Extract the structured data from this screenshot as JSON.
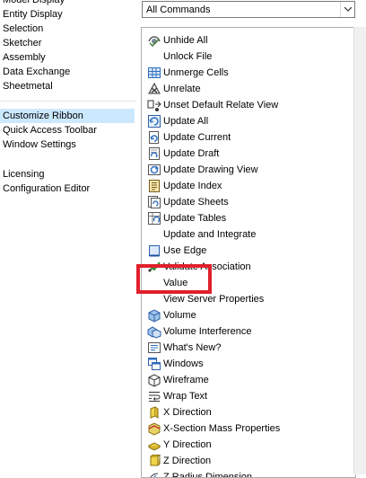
{
  "left_pane": {
    "items": [
      {
        "label": "Model Display",
        "selected": false
      },
      {
        "label": "Entity Display",
        "selected": false
      },
      {
        "label": "Selection",
        "selected": false
      },
      {
        "label": "Sketcher",
        "selected": false
      },
      {
        "label": "Assembly",
        "selected": false
      },
      {
        "label": "Data Exchange",
        "selected": false
      },
      {
        "label": "Sheetmetal",
        "selected": false
      },
      {
        "label": "Customize Ribbon",
        "selected": true
      },
      {
        "label": "Quick Access Toolbar",
        "selected": false
      },
      {
        "label": "Window Settings",
        "selected": false
      },
      {
        "label": "Licensing",
        "selected": false
      },
      {
        "label": "Configuration Editor",
        "selected": false
      }
    ]
  },
  "command_filter": {
    "selected": "All Commands"
  },
  "commands": [
    {
      "label": "Unhide All",
      "icon": "unhide-all-icon"
    },
    {
      "label": "Unlock File",
      "icon": ""
    },
    {
      "label": "Unmerge Cells",
      "icon": "unmerge-cells-icon"
    },
    {
      "label": "Unrelate",
      "icon": "unrelate-icon"
    },
    {
      "label": "Unset Default Relate View",
      "icon": "unset-default-view-icon"
    },
    {
      "label": "Update All",
      "icon": "update-all-icon"
    },
    {
      "label": "Update Current",
      "icon": "update-current-icon"
    },
    {
      "label": "Update Draft",
      "icon": "update-draft-icon"
    },
    {
      "label": "Update Drawing View",
      "icon": "update-drawing-view-icon"
    },
    {
      "label": "Update Index",
      "icon": "update-index-icon"
    },
    {
      "label": "Update Sheets",
      "icon": "update-sheets-icon"
    },
    {
      "label": "Update Tables",
      "icon": "update-tables-icon"
    },
    {
      "label": "Update and Integrate",
      "icon": ""
    },
    {
      "label": "Use Edge",
      "icon": "use-edge-icon"
    },
    {
      "label": "Validate Association",
      "icon": "validate-association-icon"
    },
    {
      "label": "Value",
      "icon": ""
    },
    {
      "label": "View Server Properties",
      "icon": ""
    },
    {
      "label": "Volume",
      "icon": "volume-icon"
    },
    {
      "label": "Volume Interference",
      "icon": "volume-interference-icon"
    },
    {
      "label": "What's New?",
      "icon": "whats-new-icon"
    },
    {
      "label": "Windows",
      "icon": "windows-icon"
    },
    {
      "label": "Wireframe",
      "icon": "wireframe-icon"
    },
    {
      "label": "Wrap Text",
      "icon": "wrap-text-icon"
    },
    {
      "label": "X Direction",
      "icon": "x-direction-icon"
    },
    {
      "label": "X-Section Mass Properties",
      "icon": "x-section-mass-icon"
    },
    {
      "label": "Y Direction",
      "icon": "y-direction-icon"
    },
    {
      "label": "Z Direction",
      "icon": "z-direction-icon"
    },
    {
      "label": "Z Radius Dimension",
      "icon": "z-radius-dimension-icon"
    }
  ],
  "highlight": {
    "color": "#e0202a",
    "target": "Value"
  },
  "colors": {
    "selection": "#cce8ff",
    "accent": "#1f6fd1"
  }
}
